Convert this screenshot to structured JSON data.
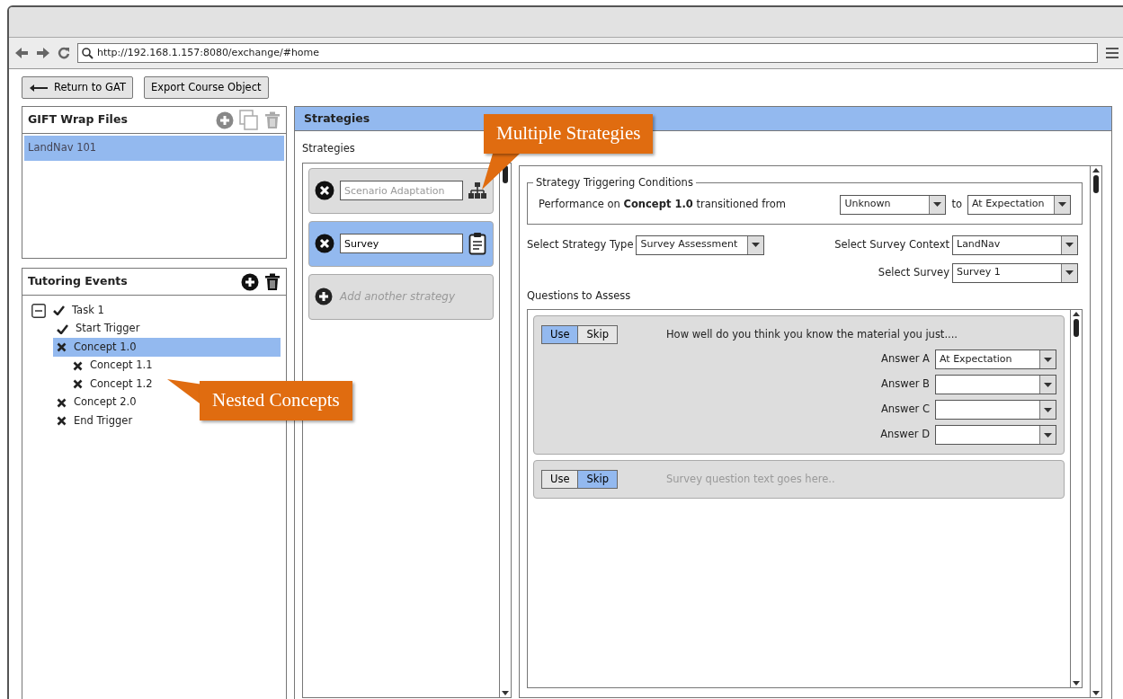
{
  "browser": {
    "url": "http://192.168.1.157:8080/exchange/#home"
  },
  "toolbar": [
    {
      "label": "Return to GAT"
    },
    {
      "label": "Export Course Object"
    }
  ],
  "files_panel": {
    "title": "GIFT Wrap Files",
    "items": [
      {
        "label": "LandNav 101",
        "selected": true
      }
    ]
  },
  "events_panel": {
    "title": "Tutoring Events",
    "tree": [
      {
        "label": "Task 1",
        "passed": true,
        "expanded": true,
        "selected": false
      },
      {
        "label": "Start Trigger",
        "passed": true,
        "selected": false
      },
      {
        "label": "Concept 1.0",
        "passed": false,
        "selected": true,
        "children": [
          {
            "label": "Concept 1.1",
            "passed": false,
            "selected": false
          },
          {
            "label": "Concept 1.2",
            "passed": false,
            "selected": false
          }
        ]
      },
      {
        "label": "Concept 2.0",
        "passed": false,
        "selected": false
      },
      {
        "label": "End Trigger",
        "passed": false,
        "selected": false
      }
    ]
  },
  "strategies_panel": {
    "title": "Strategies",
    "list_label": "Strategies",
    "items": [
      {
        "placeholder": "Scenario Adaptation",
        "selected": false
      },
      {
        "value": "Survey",
        "selected": true
      }
    ],
    "add_label": "Add another strategy",
    "conditions": {
      "legend": "Strategy Triggering Conditions",
      "sentence": "Performance on **Concept 1.0** transitioned from",
      "from": "Unknown",
      "to_label": "to",
      "to": "At Expectation"
    },
    "strategy_type": {
      "label": "Select Strategy Type",
      "value": "Survey Assessment"
    },
    "survey_context": {
      "label": "Select Survey Context",
      "value": "LandNav"
    },
    "survey": {
      "label": "Select Survey",
      "value": "Survey 1"
    },
    "questions_label": "Questions to Assess",
    "questions": [
      {
        "options": [
          {
            "label": "Use",
            "selected": true
          },
          {
            "label": "Skip",
            "selected": false
          }
        ],
        "text": "How well do you think you know the material you just....",
        "answers": [
          {
            "label": "Answer A",
            "value": "At Expectation"
          },
          {
            "label": "Answer B"
          },
          {
            "label": "Answer C"
          },
          {
            "label": "Answer D"
          }
        ]
      },
      {
        "options": [
          {
            "label": "Use",
            "selected": false
          },
          {
            "label": "Skip",
            "selected": true
          }
        ],
        "text": "Survey question text goes here.."
      }
    ]
  },
  "callouts": [
    {
      "text": "Multiple Strategies",
      "kind": "top"
    },
    {
      "text": "Nested Concepts",
      "kind": "side"
    }
  ]
}
